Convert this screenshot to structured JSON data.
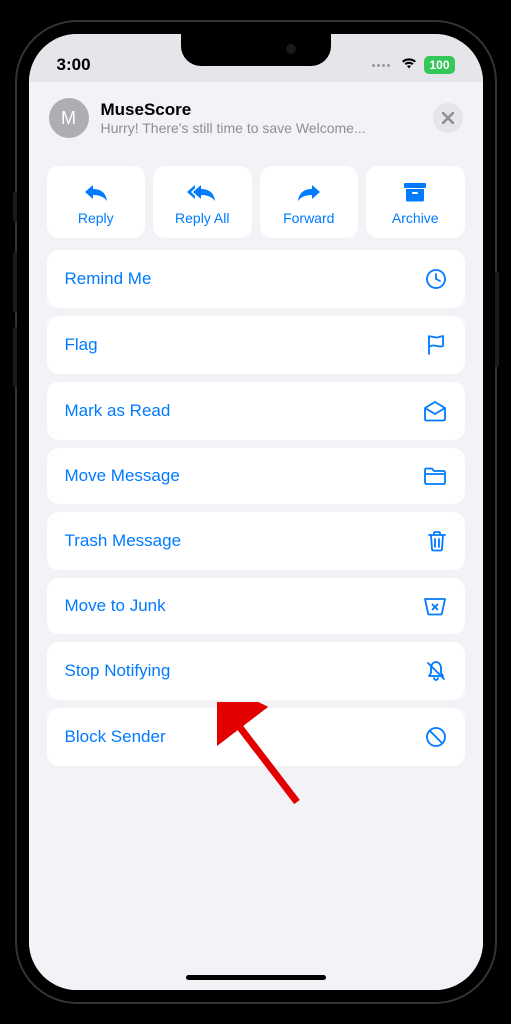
{
  "status": {
    "time": "3:00",
    "battery": "100"
  },
  "header": {
    "avatar_initial": "M",
    "sender": "MuseScore",
    "preview": "Hurry! There's still time to save Welcome..."
  },
  "actions": {
    "reply": "Reply",
    "reply_all": "Reply All",
    "forward": "Forward",
    "archive": "Archive"
  },
  "menu": {
    "remind_me": "Remind Me",
    "flag": "Flag",
    "mark_read": "Mark as Read",
    "move_message": "Move Message",
    "trash_message": "Trash Message",
    "move_junk": "Move to Junk",
    "stop_notifying": "Stop Notifying",
    "block_sender": "Block Sender"
  }
}
